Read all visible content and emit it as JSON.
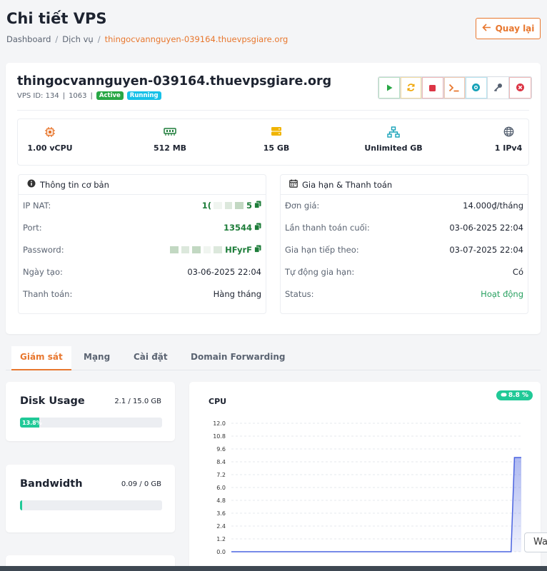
{
  "page": {
    "title": "Chi tiết VPS",
    "breadcrumb": [
      "Dashboard",
      "Dịch vụ",
      "thingocvannguyen-039164.thuevpsgiare.org"
    ],
    "back_label": "Quay lại"
  },
  "vps": {
    "hostname": "thingocvannguyen-039164.thuevpsgiare.org",
    "id_text": "VPS ID: 134",
    "id2": "1063",
    "badge_active": "Active",
    "badge_running": "Running"
  },
  "actions": [
    {
      "name": "start-button",
      "icon": "play-icon",
      "color": "#28a745"
    },
    {
      "name": "restart-button",
      "icon": "refresh-icon",
      "color": "#f0a500"
    },
    {
      "name": "stop-button",
      "icon": "stop-icon",
      "color": "#dc3545"
    },
    {
      "name": "console-button",
      "icon": "terminal-icon",
      "color": "#e8772e"
    },
    {
      "name": "vnc-button",
      "icon": "vnc-icon",
      "color": "#17a2b8"
    },
    {
      "name": "password-button",
      "icon": "key-icon",
      "color": "#556070"
    },
    {
      "name": "destroy-button",
      "icon": "close-circle-icon",
      "color": "#dc3545"
    }
  ],
  "specs": [
    {
      "label": "1.00 vCPU",
      "icon": "cpu-icon",
      "color": "#e8772e"
    },
    {
      "label": "512 MB",
      "icon": "ram-icon",
      "color": "#1e7d3a"
    },
    {
      "label": "15 GB",
      "icon": "disk-icon",
      "color": "#f0b400"
    },
    {
      "label": "Unlimited GB",
      "icon": "network-icon",
      "color": "#17a2b8"
    },
    {
      "label": "1 IPv4",
      "icon": "globe-icon",
      "color": "#556070"
    }
  ],
  "basic_info": {
    "title": "Thông tin cơ bản",
    "rows": [
      {
        "label": "IP NAT:",
        "value": "1(",
        "value_tail": "5"
      },
      {
        "label": "Port:",
        "value": "13544"
      },
      {
        "label": "Password:",
        "value": "HFyrF"
      },
      {
        "label": "Ngày tạo:",
        "value": "03-06-2025 22:04"
      },
      {
        "label": "Thanh toán:",
        "value": "Hàng tháng"
      }
    ]
  },
  "billing": {
    "title": "Gia hạn & Thanh toán",
    "rows": [
      {
        "label": "Đơn giá:",
        "value": "14.000₫/tháng"
      },
      {
        "label": "Lần thanh toán cuối:",
        "value": "03-06-2025 22:04"
      },
      {
        "label": "Gia hạn tiếp theo:",
        "value": "03-07-2025 22:04"
      },
      {
        "label": "Tự động gia hạn:",
        "value": "Có"
      },
      {
        "label": "Status:",
        "value": "Hoạt động"
      }
    ]
  },
  "tabs": [
    "Giám sát",
    "Mạng",
    "Cài đặt",
    "Domain Forwarding"
  ],
  "disk": {
    "title": "Disk Usage",
    "value": "2.1 / 15.0 GB",
    "percent_label": "13.8%",
    "percent": 13.8
  },
  "bandwidth": {
    "title": "Bandwidth",
    "value": "0.09 / 0 GB",
    "percent": 0
  },
  "cpu_chart": {
    "title": "CPU",
    "badge": "8.8 %"
  },
  "tooltip": "Wa",
  "chart_data": {
    "type": "area",
    "title": "CPU",
    "xlabel": "",
    "ylabel": "",
    "ylim": [
      0,
      12
    ],
    "yticks": [
      "12.0",
      "10.8",
      "9.6",
      "8.4",
      "7.2",
      "6.0",
      "4.8",
      "3.6",
      "2.4",
      "1.2",
      "0.0"
    ],
    "grid": true,
    "series": [
      {
        "values": [
          0,
          0,
          0,
          0,
          0,
          0,
          0,
          0,
          0,
          0,
          0,
          0,
          0,
          0,
          0,
          0,
          0,
          0,
          0,
          0,
          0,
          0,
          0,
          0,
          0,
          0,
          0,
          0,
          0,
          0,
          0,
          0,
          0,
          0,
          0,
          0,
          0,
          0,
          0,
          0,
          0,
          0,
          0,
          0,
          0,
          0,
          0,
          0,
          0,
          0,
          0,
          0,
          0,
          0,
          0,
          0,
          0,
          0,
          0,
          0,
          0,
          0,
          0,
          0,
          0,
          0,
          0,
          0,
          0,
          0,
          0,
          0,
          0,
          0,
          0,
          0,
          0,
          0,
          0,
          0,
          0,
          0,
          0,
          8.8,
          8.8,
          8.8
        ]
      }
    ]
  }
}
